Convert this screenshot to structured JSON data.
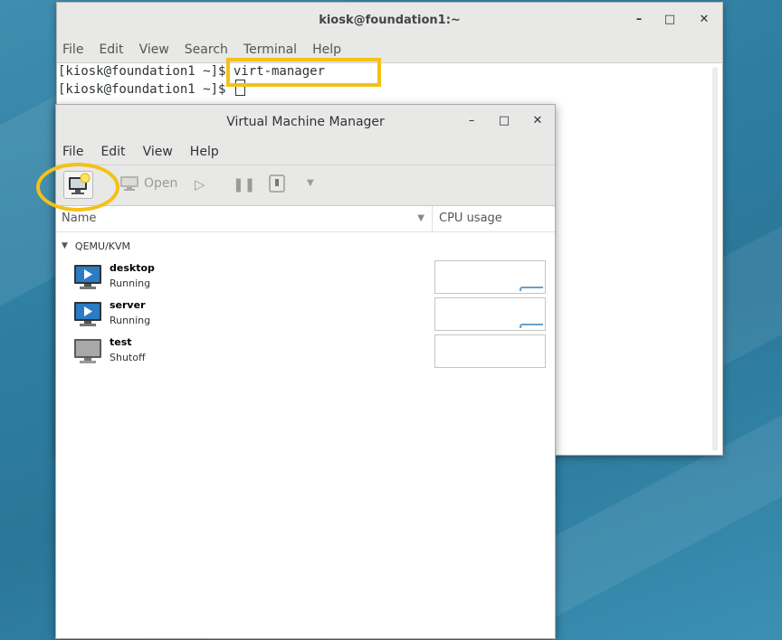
{
  "terminal": {
    "title": "kiosk@foundation1:~",
    "menu": [
      "File",
      "Edit",
      "View",
      "Search",
      "Terminal",
      "Help"
    ],
    "lines": [
      "[kiosk@foundation1 ~]$ virt-manager",
      "[kiosk@foundation1 ~]$ "
    ],
    "window_buttons": {
      "minimize": "–",
      "maximize": "□",
      "close": "✕"
    }
  },
  "vmm": {
    "title": "Virtual Machine Manager",
    "menu": [
      "File",
      "Edit",
      "View",
      "Help"
    ],
    "toolbar": {
      "open_label": "Open"
    },
    "columns": {
      "name": "Name",
      "cpu": "CPU usage"
    },
    "group": "QEMU/KVM",
    "vms": [
      {
        "name": "desktop",
        "state": "Running",
        "icon": "monitor-running-icon",
        "cpu_active": true
      },
      {
        "name": "server",
        "state": "Running",
        "icon": "monitor-running-icon",
        "cpu_active": true
      },
      {
        "name": "test",
        "state": "Shutoff",
        "icon": "monitor-off-icon",
        "cpu_active": false
      }
    ]
  },
  "colors": {
    "highlight": "#f4c116",
    "desktop": "#3a8bb0"
  }
}
